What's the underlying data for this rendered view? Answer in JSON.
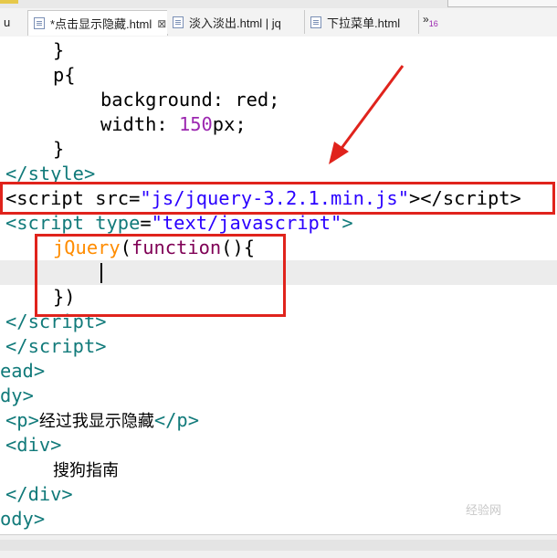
{
  "tabs": [
    {
      "label": "u",
      "close": ""
    },
    {
      "label": "*点击显示隐藏.html",
      "close": "⊠"
    },
    {
      "label": "淡入淡出.html | jq",
      "close": ""
    },
    {
      "label": "下拉菜单.html",
      "close": ""
    }
  ],
  "overflow": {
    "glyph": "»",
    "count": "16"
  },
  "code": {
    "l1": "}",
    "l2": "p{",
    "l3_prop": "background",
    "l3_val": "red",
    "l4_prop": "width",
    "l4_num": "150",
    "l4_unit": "px",
    "l5": "}",
    "l6_tag": "style",
    "l7_tag": "script",
    "l7_attr": "src",
    "l7_val": "\"js/jquery-3.2.1.min.js\"",
    "l7_end": "script",
    "l8_tag": "script",
    "l8_attr": "type",
    "l8_val": "\"text/javascript\"",
    "l9_fn": "jQuery",
    "l9_kw": "function",
    "l11": "})",
    "l12_tag": "script",
    "l13_tag": "script",
    "l14_tag": "ead",
    "l15_tag": "dy",
    "l16_tag": "p",
    "l16_text": "经过我显示隐藏",
    "l17_tag": "div",
    "l18_text": "搜狗指南",
    "l19_tag": "div",
    "l20_tag": "ody"
  },
  "watermark": "经验网",
  "colors": {
    "highlight": "#e0231c",
    "tag": "#117a7a",
    "string": "#2a00ff",
    "number": "#9c27b0",
    "function": "#ff8c00"
  }
}
